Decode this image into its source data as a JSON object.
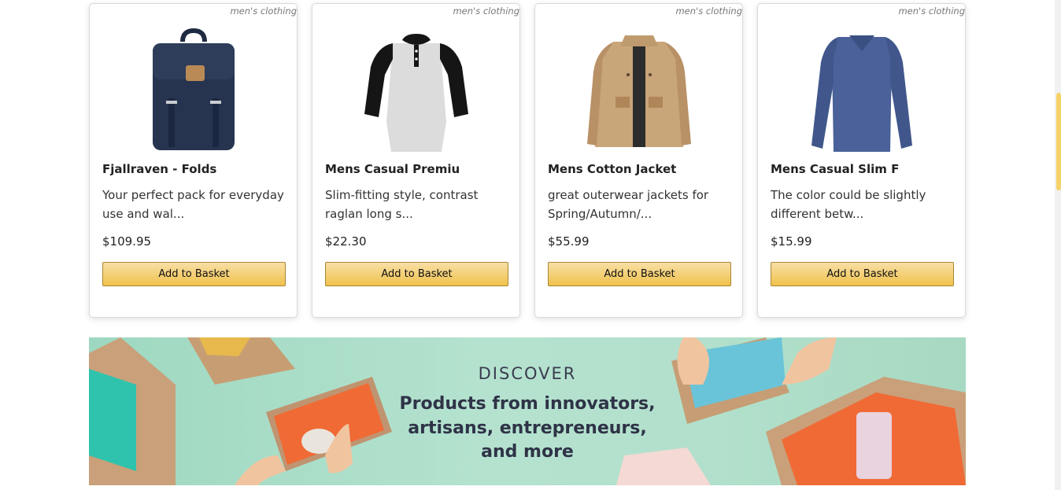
{
  "products": [
    {
      "category": "men's clothing",
      "title": "Fjallraven - Folds",
      "description": "Your perfect pack for everyday use and wal...",
      "price": "$109.95",
      "button_label": "Add to Basket",
      "image_icon": "backpack-icon"
    },
    {
      "category": "men's clothing",
      "title": "Mens Casual Premiu",
      "description": "Slim-fitting style, contrast raglan long s...",
      "price": "$22.30",
      "button_label": "Add to Basket",
      "image_icon": "raglan-tshirt-icon"
    },
    {
      "category": "men's clothing",
      "title": "Mens Cotton Jacket",
      "description": "great outerwear jackets for Spring/Autumn/...",
      "price": "$55.99",
      "button_label": "Add to Basket",
      "image_icon": "jacket-icon"
    },
    {
      "category": "men's clothing",
      "title": "Mens Casual Slim F",
      "description": "The color could be slightly different betw...",
      "price": "$15.99",
      "button_label": "Add to Basket",
      "image_icon": "long-sleeve-shirt-icon"
    }
  ],
  "banner": {
    "eyebrow": "DISCOVER",
    "line1": "Products from innovators,",
    "line2": "artisans, entrepreneurs,",
    "line3": "and more"
  },
  "colors": {
    "button_gradient_top": "#f7dfa5",
    "button_gradient_bottom": "#f0c14b",
    "banner_bg": "#b2e0cc",
    "scroll_thumb": "#f5d36a"
  }
}
